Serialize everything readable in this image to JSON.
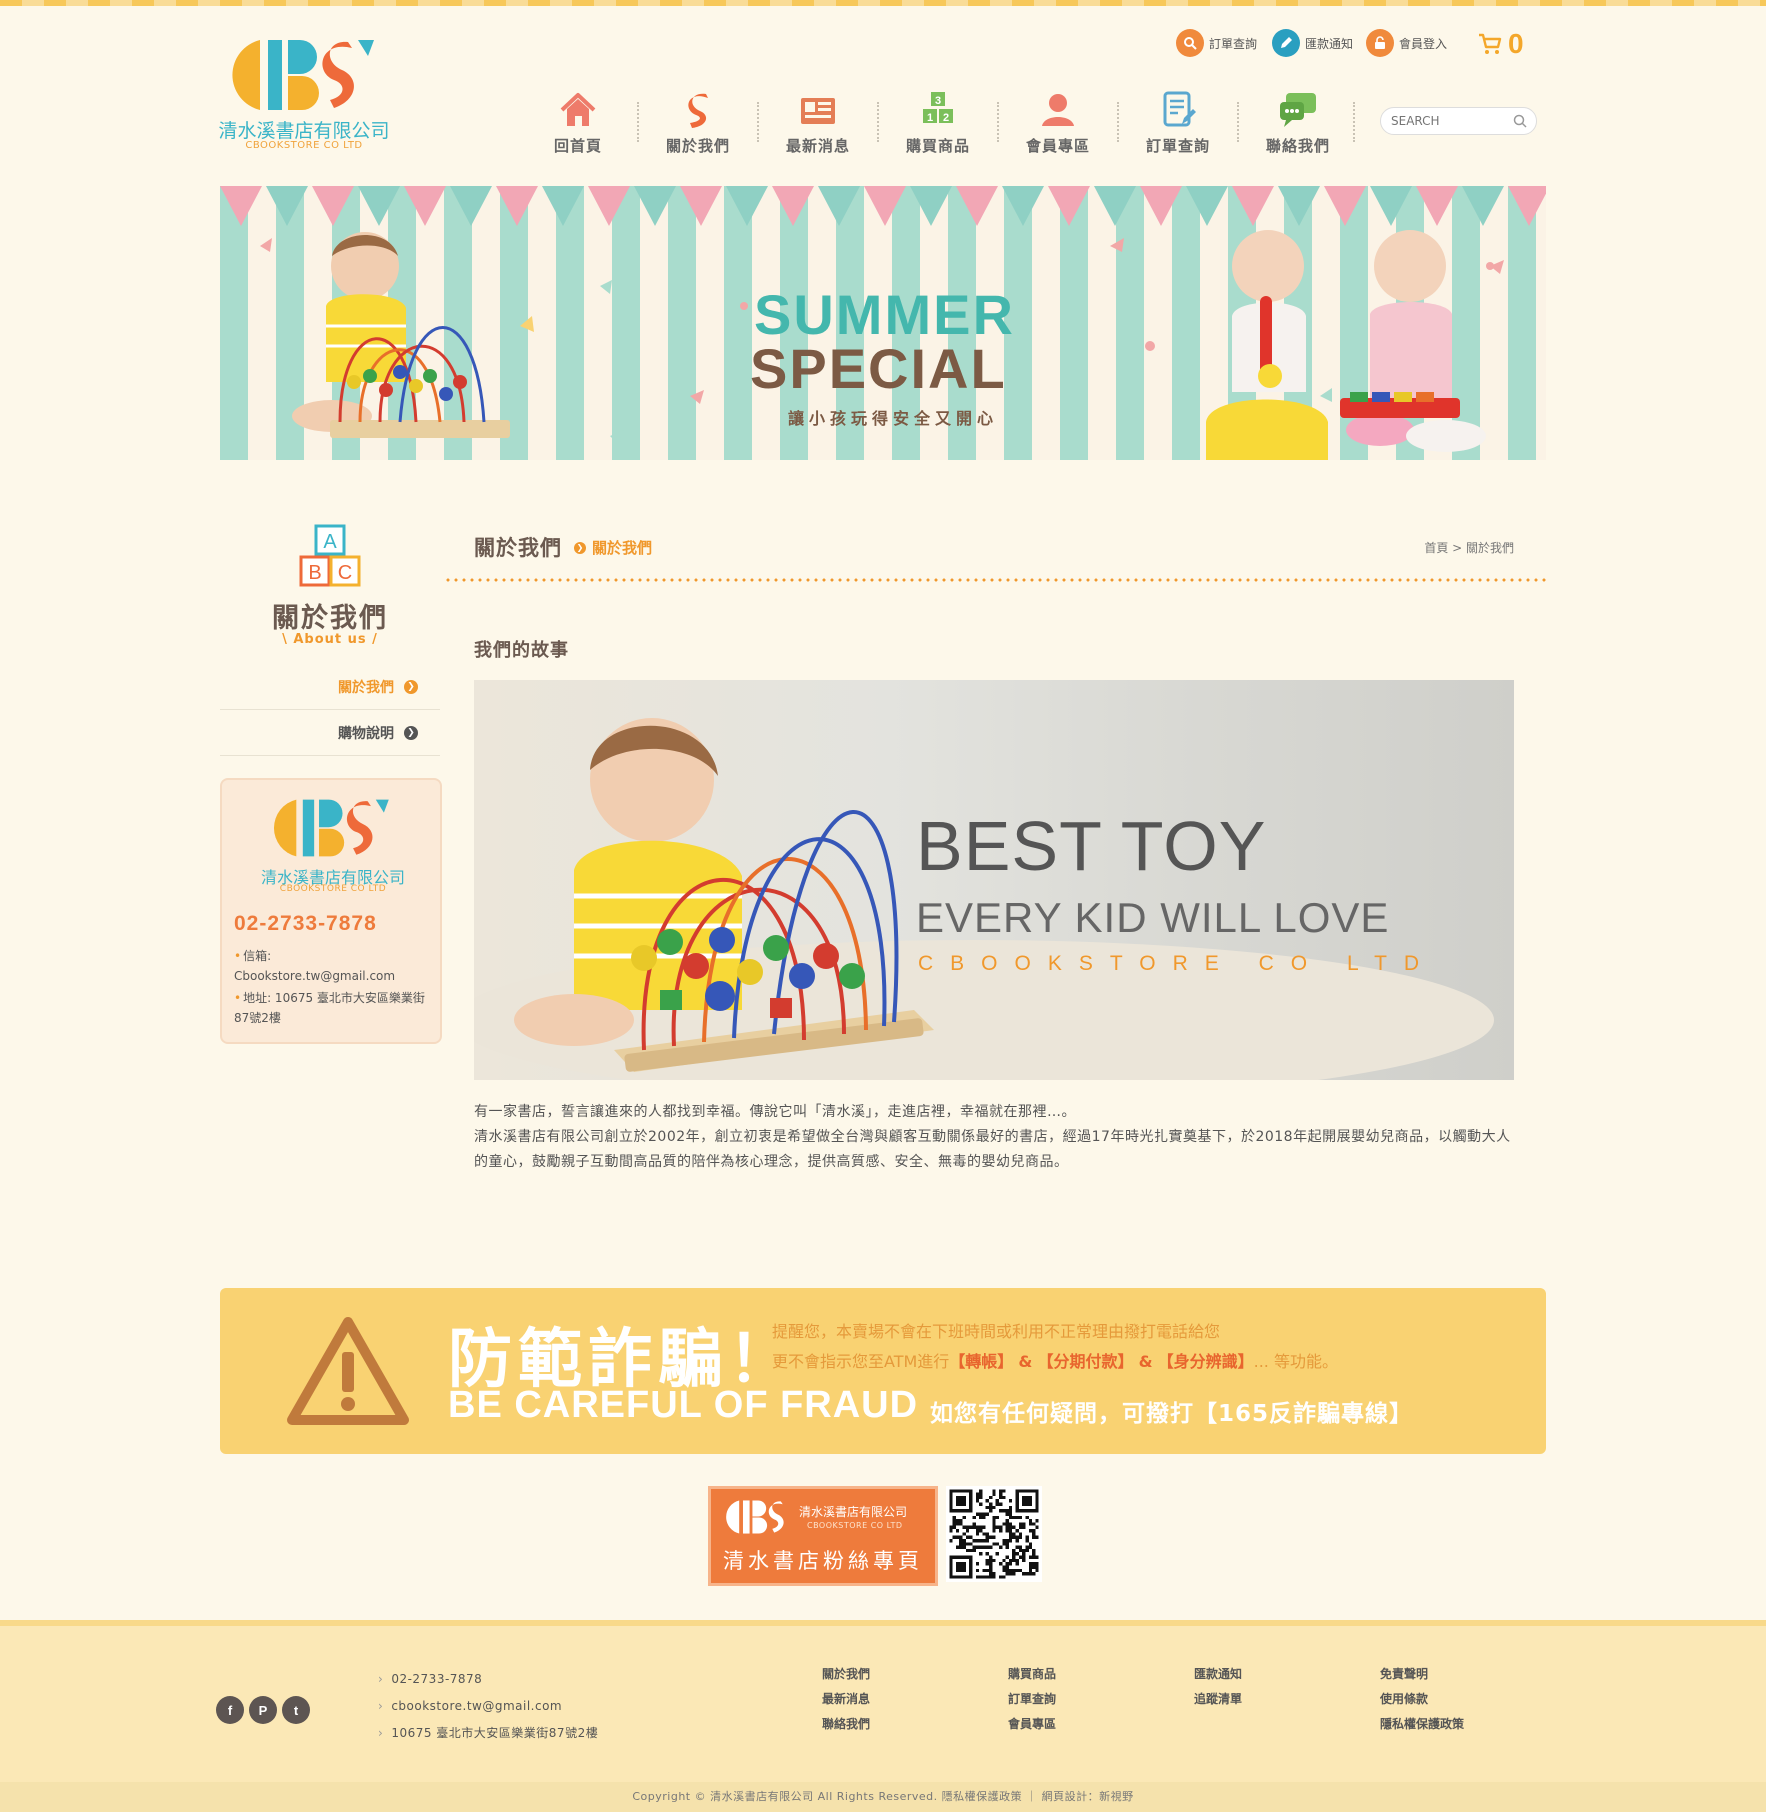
{
  "header": {
    "logo_name": "清水溪書店有限公司",
    "logo_en": "CBOOKSTORE CO LTD",
    "toplinks": [
      {
        "label": "訂單查詢",
        "icon": "search-icon",
        "color": "#f08a3c"
      },
      {
        "label": "匯款通知",
        "icon": "pencil-icon",
        "color": "#2a9fc0"
      },
      {
        "label": "會員登入",
        "icon": "lock-icon",
        "color": "#f08a3c"
      }
    ],
    "cart_count": "0",
    "nav": [
      {
        "label": "回首頁",
        "icon": "home-icon"
      },
      {
        "label": "關於我們",
        "icon": "s-logo-icon"
      },
      {
        "label": "最新消息",
        "icon": "news-icon"
      },
      {
        "label": "購買商品",
        "icon": "blocks-icon"
      },
      {
        "label": "會員專區",
        "icon": "user-icon"
      },
      {
        "label": "訂單查詢",
        "icon": "document-icon"
      },
      {
        "label": "聯絡我們",
        "icon": "chat-icon"
      }
    ],
    "search_placeholder": "SEARCH"
  },
  "banner": {
    "title_line1": "SUMMER",
    "title_line2": "SPECIAL",
    "subtitle": "讓小孩玩得安全又開心"
  },
  "sidebar": {
    "title": "關於我們",
    "subtitle": "\\ About us /",
    "menu": [
      {
        "label": "關於我們",
        "active": true
      },
      {
        "label": "購物說明",
        "active": false
      }
    ],
    "contact": {
      "name": "清水溪書店有限公司",
      "name_en": "CBOOKSTORE CO LTD",
      "phone": "02-2733-7878",
      "email_line": "信箱: Cbookstore.tw@gmail.com",
      "address_line": "地址: 10675 臺北市大安區樂業街87號2樓"
    }
  },
  "main": {
    "title": "關於我們",
    "current": "關於我們",
    "breadcrumb": "首頁 > 關於我們",
    "story_title": "我們的故事",
    "hero": {
      "line1": "BEST TOY",
      "line2": "EVERY KID WILL LOVE",
      "line3": "CBOOKSTORE CO LTD"
    },
    "paragraph1": "有一家書店，誓言讓進來的人都找到幸福。傳說它叫「清水溪」，走進店裡，幸福就在那裡…。",
    "paragraph2": "清水溪書店有限公司創立於2002年，創立初衷是希望做全台灣與顧客互動關係最好的書店，經過17年時光扎實奠基下，於2018年起開展嬰幼兒商品，以觸動大人的童心，鼓勵親子互動間高品質的陪伴為核心理念，提供高質感、安全、無毒的嬰幼兒商品。"
  },
  "fraud": {
    "title_zh": "防範詐騙！",
    "title_en": "BE CAREFUL OF FRAUD",
    "line1": "提醒您，本賣場不會在下班時間或利用不正常理由撥打電話給您",
    "line2_pre": "更不會指示您至ATM進行",
    "line2_k1": "【轉帳】",
    "line2_amp1": "&",
    "line2_k2": "【分期付款】",
    "line2_amp2": "&",
    "line2_k3": "【身分辨識】",
    "line2_post": "... 等功能。",
    "line3": "如您有任何疑問，可撥打【165反詐騙專線】"
  },
  "fanpage": {
    "name": "清水溪書店有限公司",
    "name_en": "CBOOKSTORE CO LTD",
    "label": "清水書店粉絲專頁"
  },
  "footer": {
    "phone": "02-2733-7878",
    "email": "cbookstore.tw@gmail.com",
    "address": "10675 臺北市大安區樂業街87號2樓",
    "col1": [
      "關於我們",
      "最新消息",
      "聯絡我們"
    ],
    "col2": [
      "購買商品",
      "訂單查詢",
      "會員專區"
    ],
    "col3": [
      "匯款通知",
      "追蹤清單"
    ],
    "col4": [
      "免責聲明",
      "使用條款",
      "隱私權保護政策"
    ],
    "copyright": "Copyright © 清水溪書店有限公司 All Rights Reserved. 隱私權保護政策 ｜ 網頁設計：新視野"
  },
  "colors": {
    "accent_orange": "#f0982c",
    "brand_teal": "#3ab4c8",
    "fraud_yellow": "#f9d272",
    "page_bg": "#fdf8ea"
  }
}
